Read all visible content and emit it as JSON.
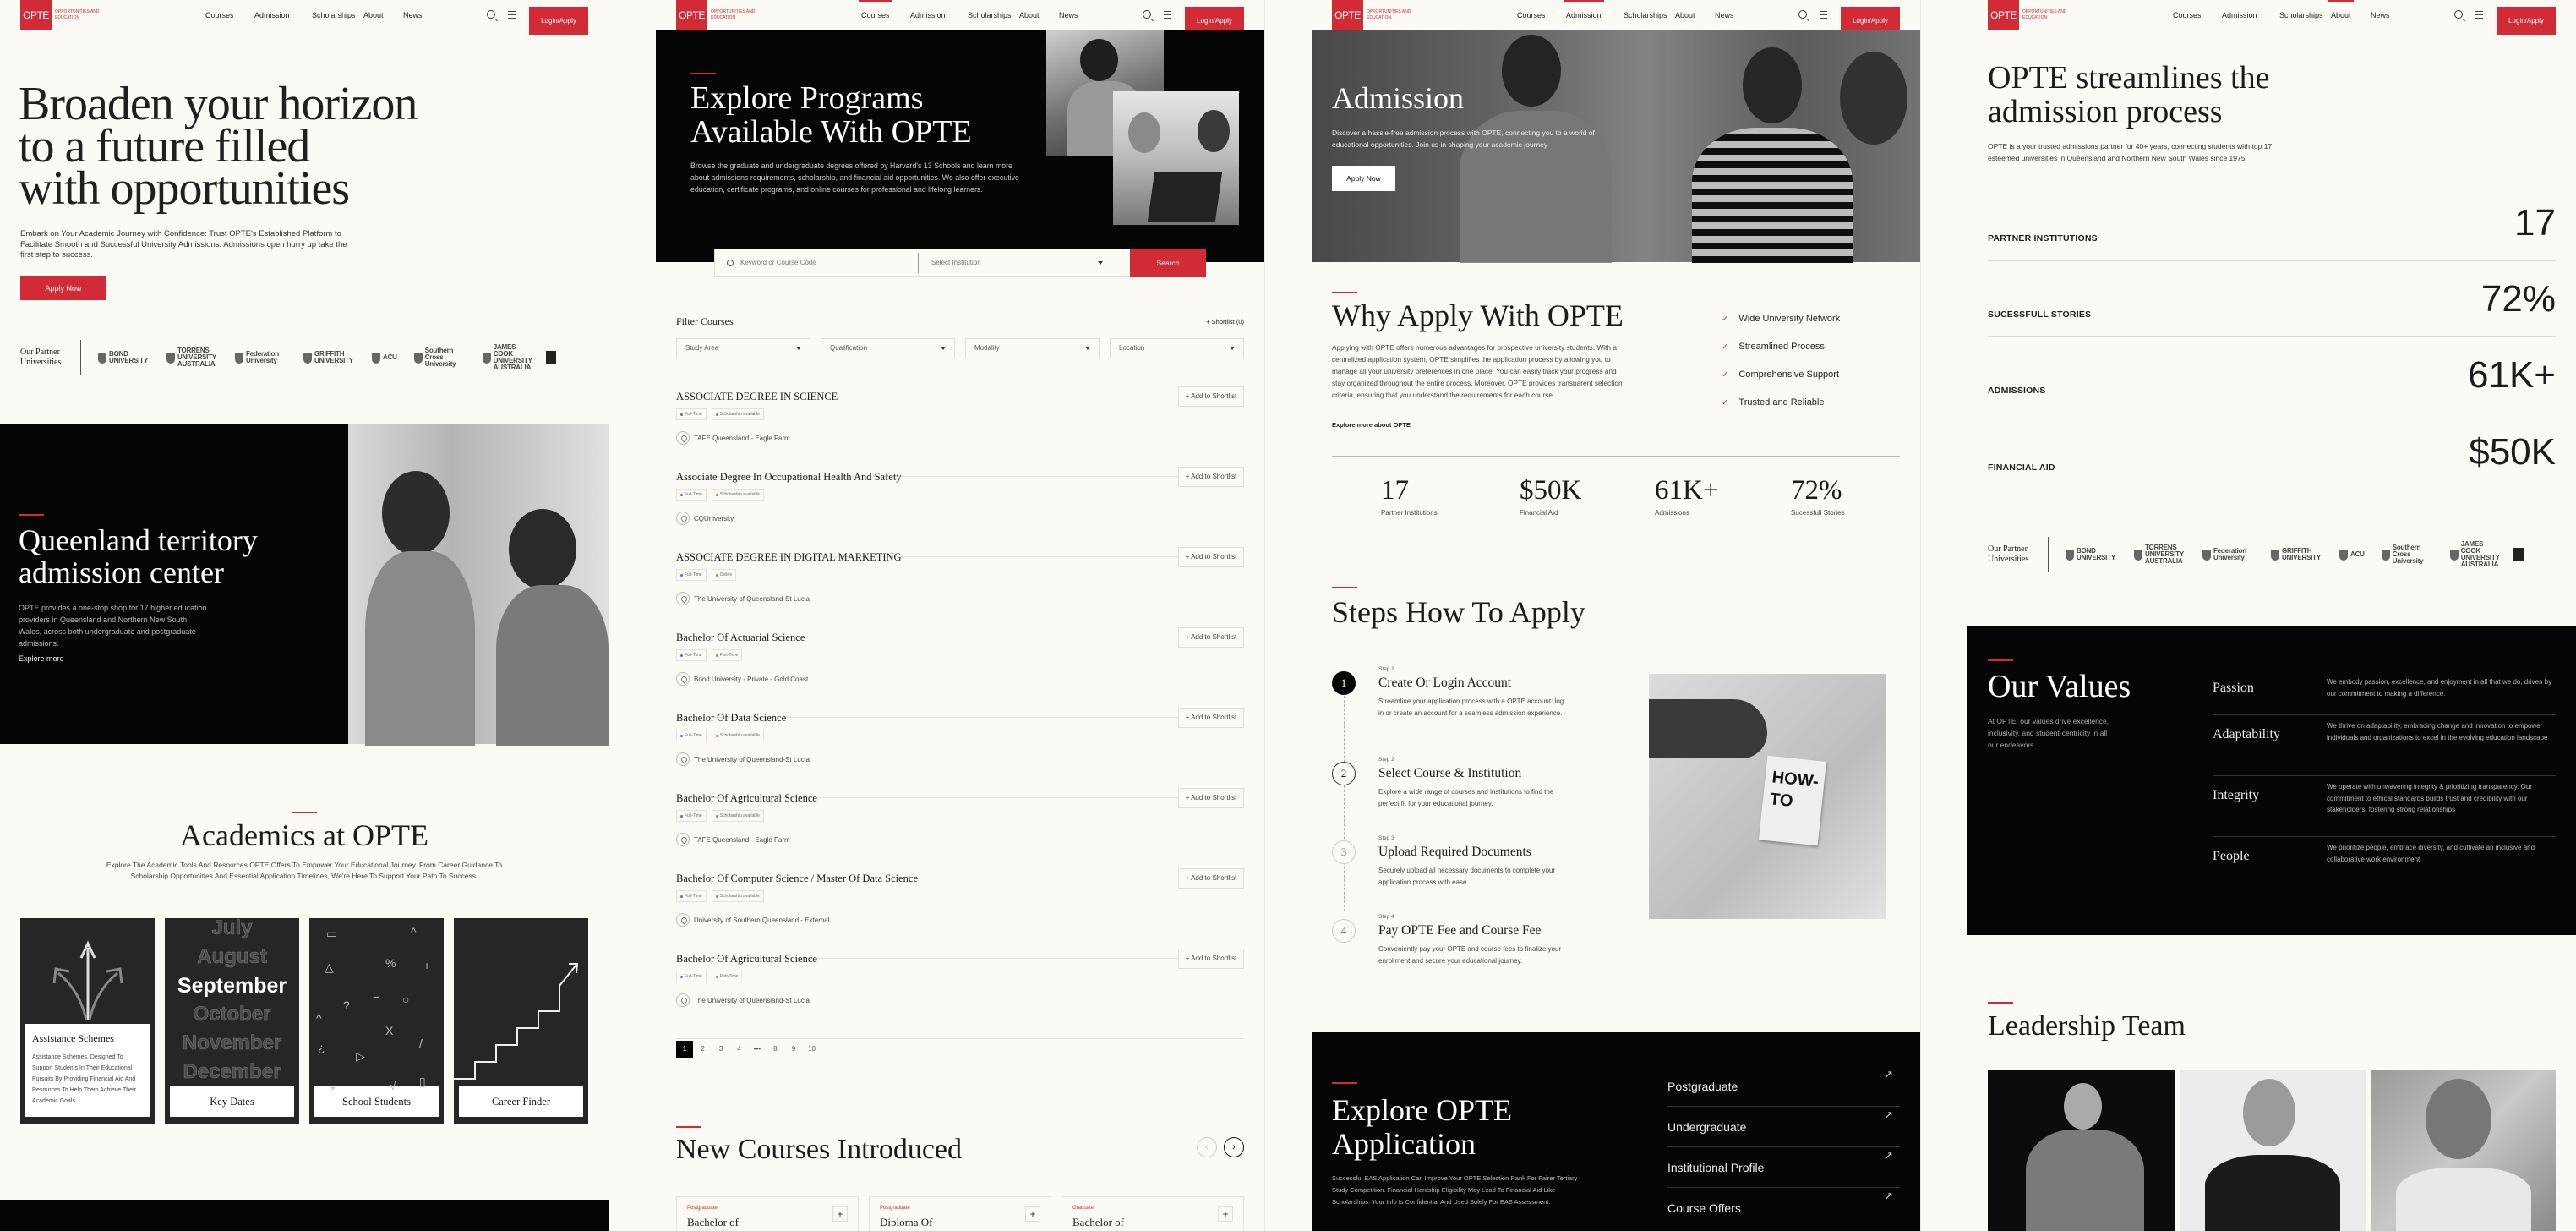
{
  "brand": {
    "logo": "OPTE",
    "tagline": "Opportunities and Education",
    "accent_color": "#d22b36"
  },
  "nav": {
    "items": [
      "Courses",
      "Admission",
      "Scholarships",
      "About",
      "News"
    ],
    "login": "Login/Apply",
    "search_icon": "search-icon",
    "menu_icon": "hamburger-menu-icon"
  },
  "partners": {
    "title": "Our Partner Universities",
    "logos": [
      "BOND UNIVERSITY",
      "TORRENS UNIVERSITY AUSTRALIA",
      "Federation University",
      "GRIFFITH UNIVERSITY",
      "ACU",
      "Southern Cross University",
      "JAMES COOK UNIVERSITY AUSTRALIA"
    ]
  },
  "home": {
    "active_nav": null,
    "hero": {
      "title_lines": [
        "Broaden your horizon",
        "to a future filled",
        "with opportunities"
      ],
      "text": "Embark on Your Academic Journey with Confidence: Trust OPTE's Established Platform to Facilitate Smooth and Successful University Admissions. Admissions open hurry up take the first step to success.",
      "cta": "Apply Now"
    },
    "territory": {
      "title_lines": [
        "Queenland territory",
        "admission center"
      ],
      "text": "OPTE provides a one-stop shop for 17 higher education providers in Queensland and Northern New South Wales, across both undergraduate and postgraduate admissions.",
      "link": "Explore more"
    },
    "academics": {
      "title": "Academics at OPTE",
      "subtitle": "Explore The Academic Tools And Resources OPTE Offers To Empower Your Educational Journey. From Career Guidance To Scholarship Opportunities And Essential Application Timelines, We're Here To Support Your Path To Success.",
      "cards": [
        {
          "title": "Assistance Schemes",
          "text": "Assistance Schemes, Designed To Support Students In Their Educational Pursuits By Providing Financial Aid And Resources To Help Them Achieve Their Academic Goals"
        },
        {
          "title": "Key Dates",
          "months": [
            "July",
            "August",
            "September",
            "October",
            "November",
            "December"
          ]
        },
        {
          "title": "School Students",
          "symbols": [
            "▭",
            "^",
            "△",
            "%",
            "+",
            "?",
            "−",
            "○",
            "^",
            "X",
            "¿",
            "/",
            "▷",
            "*",
            "√",
            "▯"
          ]
        },
        {
          "title": "Career Finder"
        }
      ]
    }
  },
  "courses_page": {
    "active_nav": 0,
    "hero": {
      "title_lines": [
        "Explore Programs",
        "Available With OPTE"
      ],
      "text": "Browse the graduate and undergraduate degrees offered by Harvard's 13 Schools and learn more about admissions requirements, scholarship, and financial aid opportunities. We also offer executive education, certificate programs, and online courses for professional and lifelong learners."
    },
    "search": {
      "keyword_placeholder": "Keyword or Course Code",
      "institution_placeholder": "Select Institution",
      "button": "Search"
    },
    "filter": {
      "title": "Filter Courses",
      "shortlist": "Shortlist (0)",
      "dropdowns": [
        "Study Area",
        "Qualification",
        "Modality",
        "Location"
      ]
    },
    "add_label": "Add to Shortlist",
    "tag_colors": {
      "primary": "#3a7bd5",
      "secondary": "#3cb44b"
    },
    "courses": [
      {
        "title": "ASSOCIATE DEGREE IN SCIENCE",
        "tags": [
          "Full-Time",
          "Scholarship available"
        ],
        "location": "TAFE Queensland - Eagle Farm"
      },
      {
        "title": "Associate Degree In Occupational Health And Safety",
        "tags": [
          "Full-Time",
          "Scholarship available"
        ],
        "location": "CQUniversity"
      },
      {
        "title": "ASSOCIATE DEGREE IN DIGITAL MARKETING",
        "tags": [
          "Full-Time",
          "Online"
        ],
        "location": "The University of Queensland-St Lucia"
      },
      {
        "title": "Bachelor Of Actuarial Science",
        "tags": [
          "Full-Time",
          "Part-Time"
        ],
        "location": "Bond University - Private - Gold Coast"
      },
      {
        "title": "Bachelor Of Data Science",
        "tags": [
          "Full-Time",
          "Scholarship available"
        ],
        "location": "The University of Queensland-St Lucia"
      },
      {
        "title": "Bachelor Of Agricultural Science",
        "tags": [
          "Full-Time",
          "Scholarship available"
        ],
        "location": "TAFE Queensland - Eagle Farm"
      },
      {
        "title": "Bachelor Of Computer Science / Master Of Data Science",
        "tags": [
          "Full-Time",
          "Scholarship available"
        ],
        "location": "University of Southern Queensland - External"
      },
      {
        "title": "Bachelor Of Agricultural Science",
        "tags": [
          "Full-Time",
          "Part-Time"
        ],
        "location": "The University of Queensland-St Lucia"
      }
    ],
    "pagination": {
      "pages": [
        "1",
        "2",
        "3",
        "4",
        "•••",
        "8",
        "9",
        "10"
      ],
      "current": "1"
    },
    "new_courses": {
      "title": "New Courses Introduced",
      "cards": [
        {
          "level": "Postgraduate",
          "title": "Bachelor of"
        },
        {
          "level": "Postgraduate",
          "title": "Diploma Of"
        },
        {
          "level": "Graduate",
          "title": "Bachelor of"
        }
      ]
    }
  },
  "admission_page": {
    "active_nav": 1,
    "hero": {
      "title": "Admission",
      "text": "Discover a hassle-free admission process with OPTE, connecting you to a world of educational opportunities. Join us in shaping your academic journey",
      "cta": "Apply Now"
    },
    "why": {
      "title": "Why Apply With OPTE",
      "text": "Applying with OPTE offers numerous advantages for prospective university students. With a centralized application system, OPTE simplifies the application process by allowing you to manage all your university preferences in one place. You can easily track your progress and stay organized throughout the entire process. Moreover, OPTE provides transparent selection criteria, ensuring that you understand the requirements for each course.",
      "link": "Explore more about OPTE",
      "checklist": [
        "Wide University Network",
        "Streamlined Process",
        "Comprehensive Support",
        "Trusted and Reliable"
      ]
    },
    "stats": [
      {
        "value": "17",
        "label": "Partner Institutions"
      },
      {
        "value": "$50K",
        "label": "Financial Aid"
      },
      {
        "value": "61K+",
        "label": "Admissions"
      },
      {
        "value": "72%",
        "label": "Sucessfull Stories"
      }
    ],
    "steps": {
      "title": "Steps How To Apply",
      "current": 1,
      "items": [
        {
          "num": "1",
          "label": "Step 1",
          "title": "Create Or Login Account",
          "text": "Streamline your application process with a OPTE account: log in or create an account for a seamless admission experience."
        },
        {
          "num": "2",
          "label": "Step 2",
          "title": "Select Course & Institution",
          "text": "Explore a wide range of courses and institutions to find the perfect fit for your educational journey."
        },
        {
          "num": "3",
          "label": "Step 3",
          "title": "Upload Required Documents",
          "text": "Securely upload all necessary documents to complete your application process with ease."
        },
        {
          "num": "4",
          "label": "Step 4",
          "title": "Pay OPTE Fee and Course Fee",
          "text": "Conveniently pay your OPTE and course fees to finalize your enrollment and secure your educational journey."
        }
      ],
      "image_note": "HOW-TO"
    },
    "explore": {
      "title_lines": [
        "Explore OPTE",
        "Application"
      ],
      "text": "Successful EAS Application Can Improve Your OPTE Selection Rank For Fairer Tertiary Study Competition. Financial Hardship Eligibility May Lead To Financial Aid Like Scholarships. Your Info Is Confidential And Used Solely For EAS Assessment.",
      "links": [
        "Postgraduate",
        "Undergraduate",
        "Institutional Profile",
        "Course Offers"
      ]
    }
  },
  "about_page": {
    "active_nav": 3,
    "hero": {
      "title_lines": [
        "OPTE streamlines the",
        "admission process"
      ],
      "text": "OPTE is a your trusted admissions partner for 40+ years, connecting students with top 17 esteemed universities in Queensland and Northern New South Wales since 1975."
    },
    "stats": [
      {
        "label": "PARTNER INSTITUTIONS",
        "value": "17"
      },
      {
        "label": "SUCESSFULL STORIES",
        "value": "72%"
      },
      {
        "label": "ADMISSIONS",
        "value": "61K+"
      },
      {
        "label": "FINANCIAL AID",
        "value": "$50K"
      }
    ],
    "values": {
      "title": "Our Values",
      "text": "At OPTE, our values drive excellence, inclusivity, and student-centricity in all our endeavors",
      "items": [
        {
          "name": "Passion",
          "text": "We embody passion, excellence, and enjoyment in all that we do, driven by our commitment to making a difference."
        },
        {
          "name": "Adaptability",
          "text": "We thrive on adaptability, embracing change and innovation to empower individuals and organizations to excel in the evolving education landscape"
        },
        {
          "name": "Integrity",
          "text": "We operate with unwavering integrity & prioritizing transparency. Our commitment to ethical standards builds trust and credibility with our stakeholders, fostering strong relationships"
        },
        {
          "name": "People",
          "text": "We prioritize people, embrace diversity, and cultivate an inclusive and collaborative work environment"
        }
      ]
    },
    "leadership": {
      "title": "Leadership Team"
    }
  }
}
